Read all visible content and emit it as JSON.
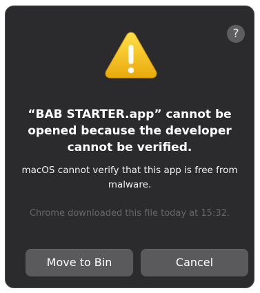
{
  "dialog": {
    "help_label": "?",
    "icon": "warning-icon",
    "title": "“BAB STARTER.app” cannot be opened because the developer cannot be verified.",
    "message": "macOS cannot verify that this app is free from malware.",
    "info": "Chrome downloaded this file today at 15:32.",
    "buttons": {
      "move_to_bin": "Move to Bin",
      "cancel": "Cancel"
    }
  },
  "colors": {
    "dialog_background": "#2b2b2d",
    "button_background": "#5a5a5c",
    "warning_yellow": "#f5c518",
    "info_text": "#66666a"
  }
}
